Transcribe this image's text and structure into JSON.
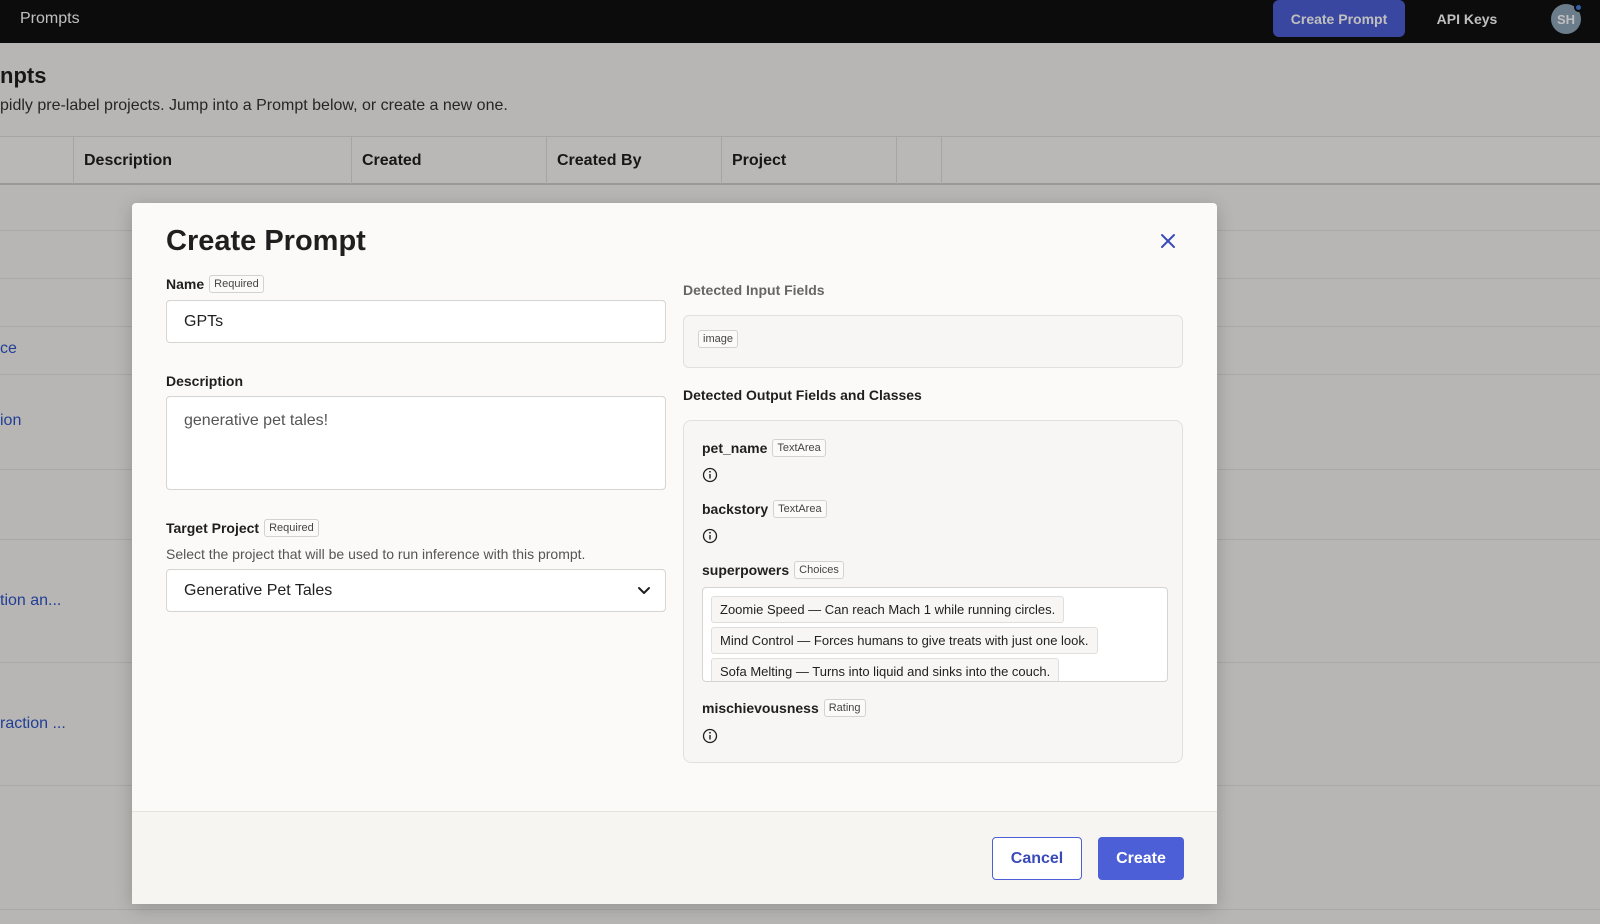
{
  "topbar": {
    "app_title": "Prompts",
    "create_prompt_label": "Create Prompt",
    "api_keys_label": "API Keys",
    "avatar_initials": "SH"
  },
  "page": {
    "title": "npts",
    "subtitle": "pidly pre-label projects. Jump into a Prompt below, or create a new one.",
    "columns": [
      "Description",
      "Created",
      "Created By",
      "Project"
    ],
    "row_links": [
      "ce",
      "ion",
      "tion an...",
      "raction ..."
    ]
  },
  "modal": {
    "title": "Create Prompt",
    "name": {
      "label": "Name",
      "required": "Required",
      "value": "GPTs"
    },
    "description": {
      "label": "Description",
      "value": "generative pet tales!"
    },
    "target_project": {
      "label": "Target Project",
      "required": "Required",
      "help": "Select the project that will be used to run inference with this prompt.",
      "selected": "Generative Pet Tales"
    },
    "detected_input": {
      "label": "Detected Input Fields",
      "fields": [
        "image"
      ]
    },
    "detected_output": {
      "label": "Detected Output Fields and Classes",
      "fields": [
        {
          "name": "pet_name",
          "type": "TextArea"
        },
        {
          "name": "backstory",
          "type": "TextArea"
        },
        {
          "name": "superpowers",
          "type": "Choices"
        },
        {
          "name": "mischievousness",
          "type": "Rating"
        }
      ],
      "choices": [
        "Zoomie Speed — Can reach Mach 1 while running circles.",
        "Mind Control — Forces humans to give treats with just one look.",
        "Sofa Melting — Turns into liquid and sinks into the couch."
      ]
    },
    "cancel_label": "Cancel",
    "create_label": "Create"
  },
  "colors": {
    "accent": "#4d5fd6",
    "topbar": "#111111",
    "link": "#2f55c7"
  }
}
